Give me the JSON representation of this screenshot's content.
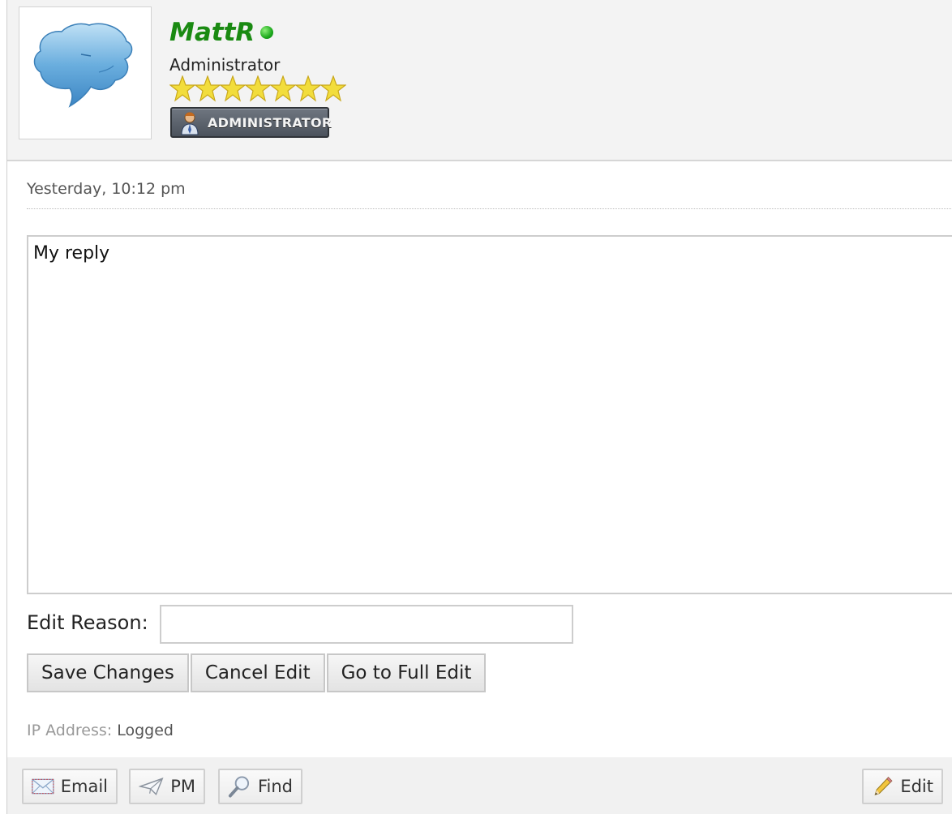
{
  "author": {
    "username": "MattR",
    "online": true,
    "role": "Administrator",
    "stars": 7,
    "badge_text": "ADMINISTRATOR",
    "name_color": "#1a8a12",
    "online_color": "#1ca81c"
  },
  "post": {
    "date": "Yesterday, 10:12 pm"
  },
  "editor": {
    "content": "My reply",
    "edit_reason_label": "Edit Reason:",
    "edit_reason_value": ""
  },
  "actions": {
    "save": "Save Changes",
    "cancel": "Cancel Edit",
    "full_edit": "Go to Full Edit"
  },
  "ip": {
    "label": "IP Address:",
    "value": "Logged"
  },
  "footer": {
    "email": "Email",
    "pm": "PM",
    "find": "Find",
    "edit": "Edit"
  },
  "icons": {
    "avatar": "speech-bubble-icon",
    "email": "envelope-icon",
    "pm": "paper-plane-icon",
    "find": "magnifier-icon",
    "edit": "pencil-icon",
    "star": "star-icon",
    "badge": "administrator-person-icon"
  }
}
